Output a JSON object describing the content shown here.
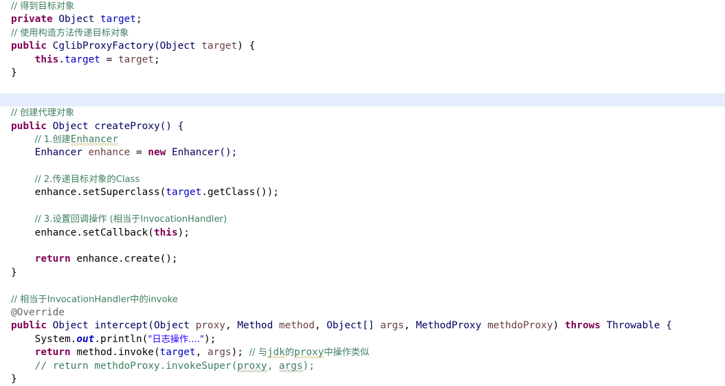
{
  "editor": {
    "background_color": "#ffffff",
    "highlight_line_color": "#e4edfb",
    "language": "java",
    "colors": {
      "comment": "#3f7f5f",
      "keyword": "#7f0055",
      "type": "#000060",
      "field": "#0000c0",
      "parameter": "#6a3e3e",
      "string": "#2a00ff",
      "annotation": "#646464",
      "plain": "#000000",
      "squiggle_warning": "#b5a642",
      "squiggle_grey": "#8a8a6a"
    }
  },
  "code": {
    "l01_comment": "// 得到目标对象",
    "l02_kw_private": "private",
    "l02_type_object": "Object",
    "l02_field_target": "target",
    "l02_semi": ";",
    "l03_comment": "// 使用构造方法传递目标对象",
    "l04_kw_public": "public",
    "l04_ctor_name": "CglibProxyFactory(",
    "l04_type_object": "Object",
    "l04_param_target": "target",
    "l04_tail": ") {",
    "l05_kw_this": "this",
    "l05_dot": ".",
    "l05_field_target": "target",
    "l05_eq": " = ",
    "l05_param_target": "target",
    "l05_semi": ";",
    "l06_close": "}",
    "l08_comment": "// 创建代理对象",
    "l09_kw_public": "public",
    "l09_type_object": "Object",
    "l09_method": "createProxy() {",
    "l10_comment_pre": "// 1.创建",
    "l10_comment_sq": "Enhancer",
    "l11_type_enhancer": "Enhancer",
    "l11_var_enhance": "enhance",
    "l11_eq": " = ",
    "l11_kw_new": "new",
    "l11_ctor": "Enhancer();",
    "l13_comment": "// 2.传递目标对象的Class",
    "l14_var": "enhance",
    "l14_call": ".setSuperclass(",
    "l14_field_target": "target",
    "l14_tail": ".getClass());",
    "l16_comment": "// 3.设置回调操作 (相当于InvocationHandler)",
    "l17_var": "enhance",
    "l17_call": ".setCallback(",
    "l17_kw_this": "this",
    "l17_tail": ");",
    "l19_kw_return": "return",
    "l19_expr": "enhance.create();",
    "l20_close": "}",
    "l22_comment": "// 相当于InvocationHandler中的invoke",
    "l23_annotation": "@Override",
    "l24_kw_public": "public",
    "l24_type_object": "Object",
    "l24_method": "intercept(",
    "l24_t1": "Object",
    "l24_p1": "proxy",
    "l24_c1": ", ",
    "l24_t2": "Method",
    "l24_p2": "method",
    "l24_c2": ", ",
    "l24_t3": "Object[]",
    "l24_p3": "args",
    "l24_c3": ", ",
    "l24_t4": "MethodProxy",
    "l24_p4": "methdoProxy",
    "l24_rp": ") ",
    "l24_kw_throws": "throws",
    "l24_exc": " Throwable {",
    "l25_sys": "System",
    "l25_dot1": ".",
    "l25_out": "out",
    "l25_print": ".println(",
    "l25_str": "\"日志操作....\"",
    "l25_tail": ");",
    "l26_kw_return": "return",
    "l26_expr_a": "method.invoke(",
    "l26_field_target": "target",
    "l26_comma": ", ",
    "l26_param_args": "args",
    "l26_expr_b": "); ",
    "l26_comment_a": "// 与",
    "l26_comment_sq1": "jdk",
    "l26_comment_b": "的",
    "l26_comment_sq2": "proxy",
    "l26_comment_c": "中操作类似",
    "l27_comment_a": "// return methdoProxy.invokeSuper(",
    "l27_comment_sq1": "proxy",
    "l27_comment_b": ", ",
    "l27_comment_sq2": "args",
    "l27_comment_c": ");",
    "l28_close": "}"
  }
}
